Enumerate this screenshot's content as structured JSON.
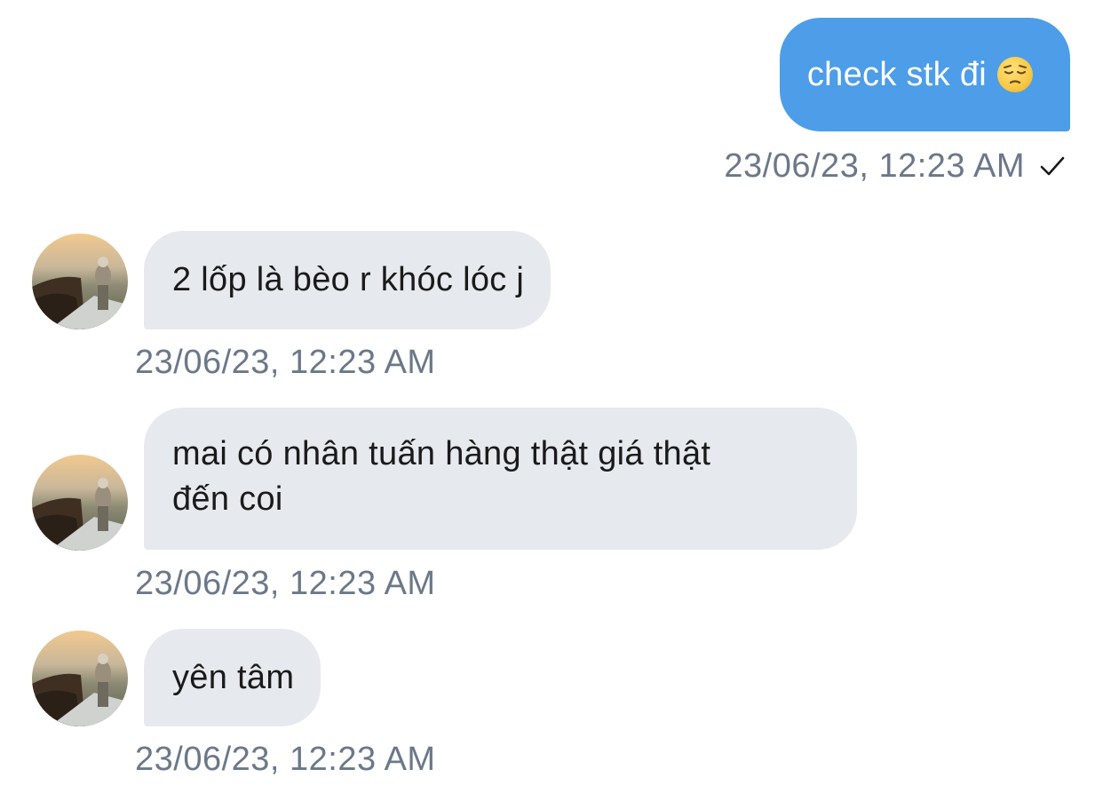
{
  "messages": [
    {
      "direction": "outgoing",
      "text": "check stk đi",
      "emoji": "pensive-face-emoji",
      "timestamp": "23/06/23, 12:23 AM",
      "status_icon": "checkmark-icon"
    },
    {
      "direction": "incoming",
      "text": "2 lốp là bèo r khóc lóc j",
      "timestamp": "23/06/23, 12:23 AM",
      "avatar": "contact-avatar"
    },
    {
      "direction": "incoming",
      "lines": [
        "mai có nhân tuấn hàng thật giá thật",
        "đến coi"
      ],
      "timestamp": "23/06/23, 12:23 AM",
      "avatar": "contact-avatar"
    },
    {
      "direction": "incoming",
      "text": "yên tâm",
      "timestamp": "23/06/23, 12:23 AM",
      "avatar": "contact-avatar"
    }
  ],
  "colors": {
    "outgoing_bubble": "#4d9de8",
    "incoming_bubble": "#e6e9ee",
    "timestamp": "#6b7889"
  }
}
